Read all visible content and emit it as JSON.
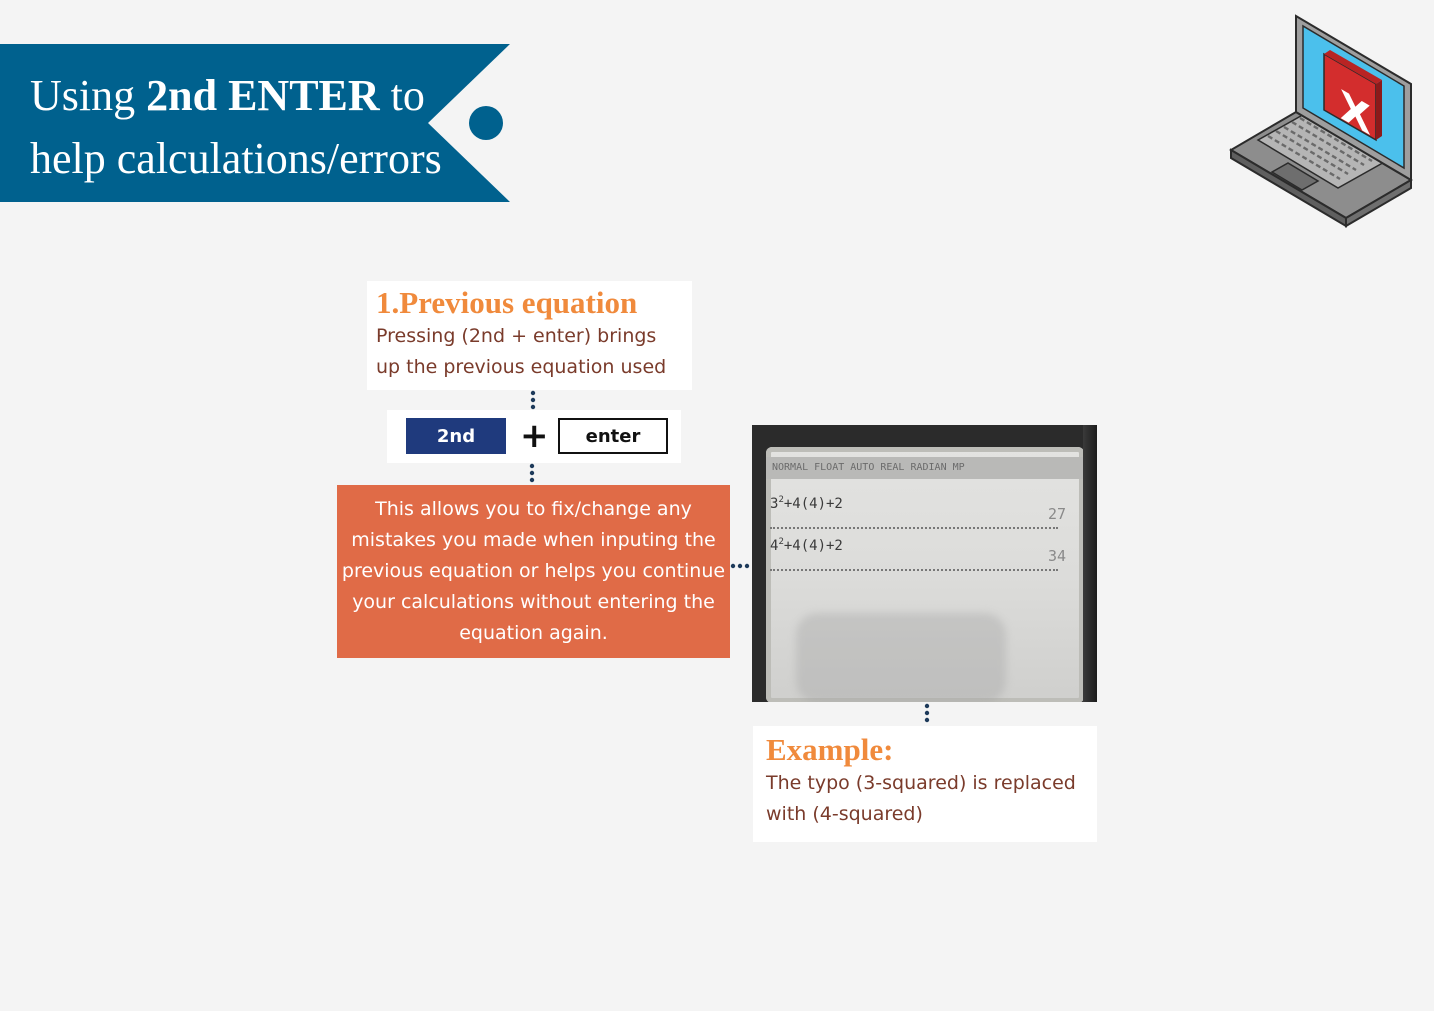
{
  "banner": {
    "title_line1_pre": "Using ",
    "title_line1_bold": "2nd ENTER",
    "title_line1_post": " to",
    "title_line2": "help calculations/errors",
    "color": "#00618e"
  },
  "laptop_icon": {
    "icon": "laptop-error-icon",
    "badge_letter": "X"
  },
  "previous": {
    "heading": "1.Previous equation",
    "body": "Pressing (2nd + enter) brings up the previous equation used"
  },
  "keys": {
    "first": "2nd",
    "operator": "+",
    "second": "enter"
  },
  "explanation": {
    "text": "This allows you to fix/change any mistakes you made when inputing the previous equation or helps you continue your calculations without entering the equation again.",
    "color": "#e06b47"
  },
  "calculator": {
    "status": "NORMAL FLOAT AUTO REAL RADIAN MP",
    "row1_base": "3",
    "row1_exp": "2",
    "row1_rest": "+4(4)+2",
    "row1_result": "27",
    "row2_base": "4",
    "row2_exp": "2",
    "row2_rest": "+4(4)+2",
    "row2_result": "34"
  },
  "example": {
    "heading": "Example:",
    "body": "The typo (3-squared) is replaced with (4-squared)"
  },
  "colors": {
    "accent_orange": "#f08a3c",
    "body_text": "#7a3b2b",
    "key_blue": "#1f3a7d",
    "background": "#f4f4f4"
  }
}
